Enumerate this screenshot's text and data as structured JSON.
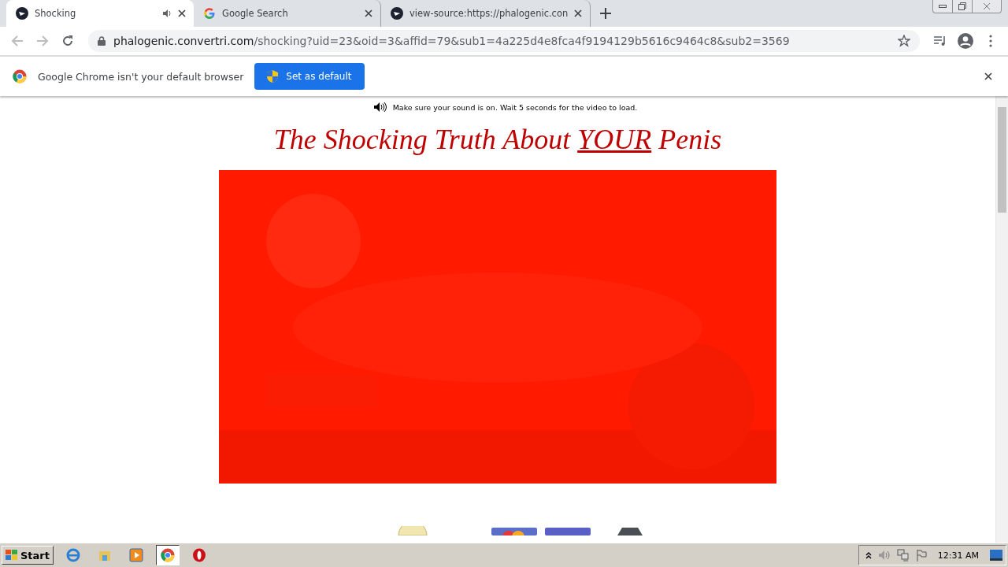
{
  "tabs": [
    {
      "title": "Shocking",
      "selected": true,
      "audio": true,
      "kind": "site"
    },
    {
      "title": "Google Search",
      "selected": false,
      "audio": false,
      "kind": "google"
    },
    {
      "title": "view-source:https://phalogenic.con",
      "selected": false,
      "audio": false,
      "kind": "site"
    }
  ],
  "address": {
    "host": "phalogenic.convertri.com",
    "path": "/shocking?uid=23&oid=3&affid=79&sub1=4a225d4e8fca4f9194129b5616c9464c8&sub2=3569"
  },
  "infobar": {
    "message": "Google Chrome isn't your default browser",
    "button": "Set as default"
  },
  "page": {
    "notice": "Make sure your sound is on. Wait 5 seconds for the video to load.",
    "headline_before": "The Shocking Truth About ",
    "headline_emph": "YOUR",
    "headline_after": " Penis"
  },
  "taskbar": {
    "start": "Start",
    "apps": [
      {
        "kind": "ie",
        "selected": false
      },
      {
        "kind": "explorer",
        "selected": false
      },
      {
        "kind": "media",
        "selected": false
      },
      {
        "kind": "chrome",
        "selected": true
      },
      {
        "kind": "opera",
        "selected": false
      }
    ],
    "clock": "12:31 AM"
  }
}
